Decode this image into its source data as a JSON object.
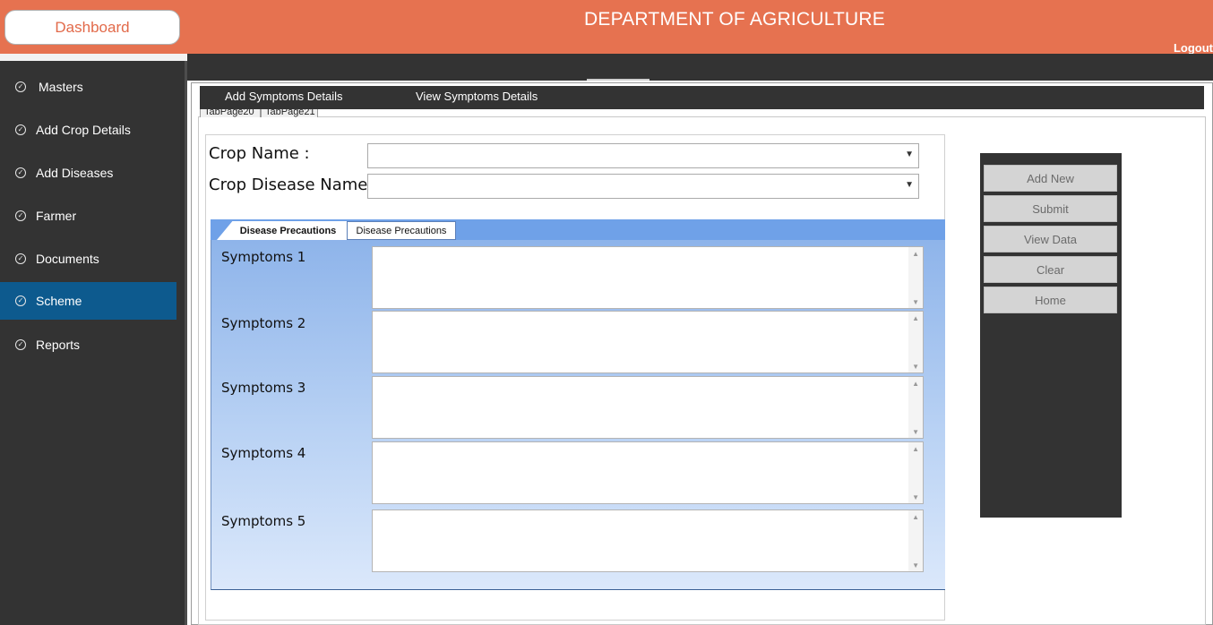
{
  "header": {
    "dashboard_label": "Dashboard",
    "title": "DEPARTMENT OF AGRICULTURE",
    "logout_label": "Logout"
  },
  "sidebar": {
    "items": [
      {
        "label": "Masters",
        "icon": "check-circle-icon",
        "active": false
      },
      {
        "label": "Add Crop Details",
        "icon": "check-circle-icon",
        "active": false
      },
      {
        "label": "Add Diseases",
        "icon": "check-circle-icon",
        "active": false
      },
      {
        "label": "Farmer",
        "icon": "check-circle-icon",
        "active": false
      },
      {
        "label": "Documents",
        "icon": "check-circle-icon",
        "active": false
      },
      {
        "label": "Scheme",
        "icon": "check-circle-icon",
        "active": true
      },
      {
        "label": "Reports",
        "icon": "check-circle-icon",
        "active": false
      }
    ]
  },
  "menubar": {
    "add_label": "Add Symptoms Details",
    "view_label": "View Symptoms Details"
  },
  "outer_tabs": [
    "TabPage20",
    "TabPage21"
  ],
  "form": {
    "crop_name_label": "Crop Name :",
    "crop_name_value": "",
    "crop_disease_label": "Crop Disease Name",
    "crop_disease_value": ""
  },
  "inner_tabs": [
    "Disease Precautions",
    "Disease Precautions"
  ],
  "symptoms": [
    {
      "label": "Symptoms 1",
      "value": ""
    },
    {
      "label": "Symptoms 2",
      "value": ""
    },
    {
      "label": "Symptoms 3",
      "value": ""
    },
    {
      "label": "Symptoms 4",
      "value": ""
    },
    {
      "label": "Symptoms 5",
      "value": ""
    }
  ],
  "actions": {
    "add_new": "Add New",
    "submit": "Submit",
    "view_data": "View Data",
    "clear": "Clear",
    "home": "Home"
  },
  "colors": {
    "header": "#e67250",
    "sidebar": "#333333",
    "active_item": "#0d5a8e",
    "tab_strip": "#6fa1e8"
  }
}
